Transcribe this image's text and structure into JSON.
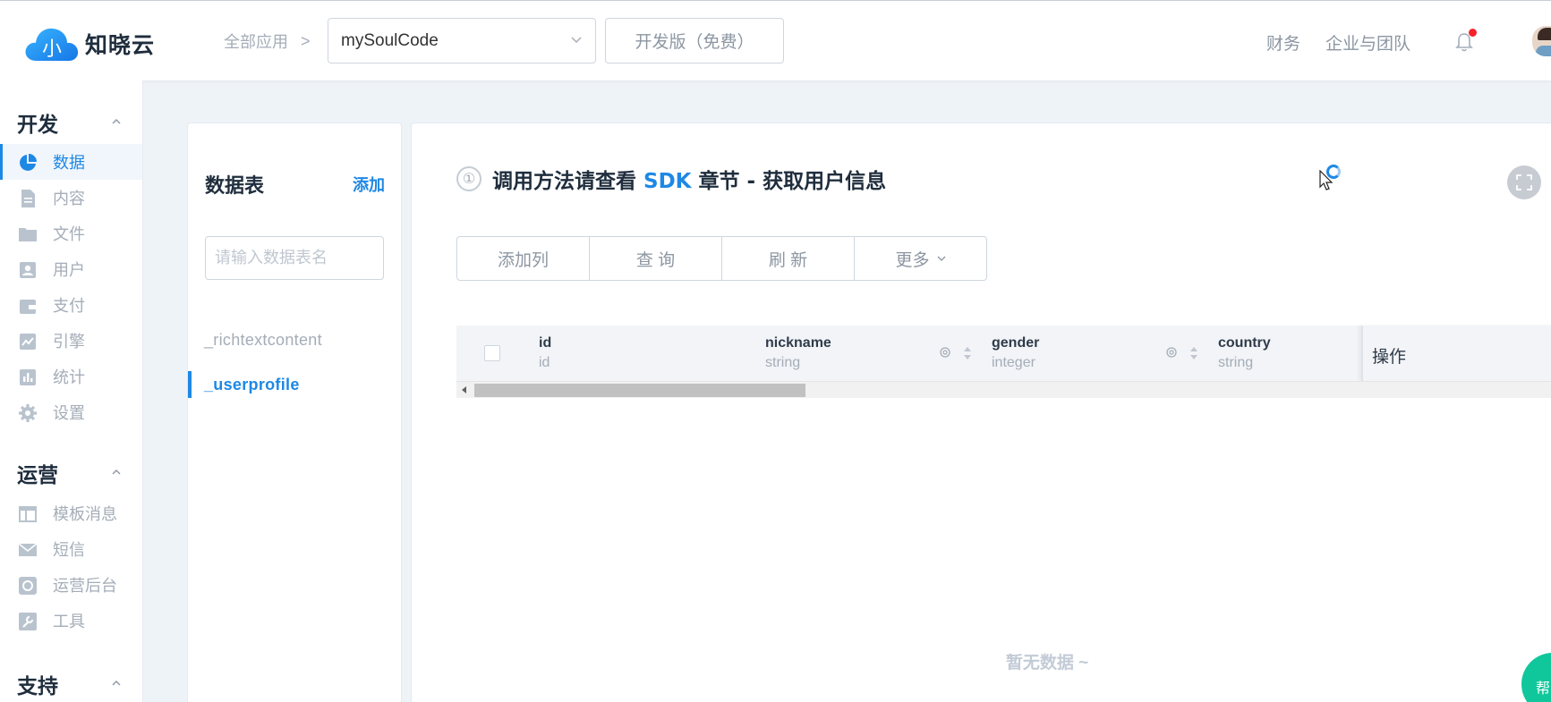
{
  "brand": {
    "name": "知晓云",
    "logo_glyph": "小",
    "brand_color": "#1e88e5"
  },
  "header": {
    "breadcrumb": "全部应用",
    "breadcrumb_separator": ">",
    "app_selected": "mySoulCode",
    "plan_label": "开发版（免费）",
    "links": [
      "财务",
      "企业与团队"
    ],
    "notification_icon": "bell-icon",
    "has_unread": true
  },
  "sidebar": {
    "sections": [
      {
        "title": "开发",
        "items": [
          {
            "label": "数据",
            "icon": "pie-chart-icon",
            "active": true
          },
          {
            "label": "内容",
            "icon": "document-icon"
          },
          {
            "label": "文件",
            "icon": "folder-icon"
          },
          {
            "label": "用户",
            "icon": "user-card-icon"
          },
          {
            "label": "支付",
            "icon": "wallet-icon"
          },
          {
            "label": "引擎",
            "icon": "trend-chart-icon"
          },
          {
            "label": "统计",
            "icon": "bar-chart-icon"
          },
          {
            "label": "设置",
            "icon": "gear-icon"
          }
        ]
      },
      {
        "title": "运营",
        "items": [
          {
            "label": "模板消息",
            "icon": "template-icon"
          },
          {
            "label": "短信",
            "icon": "mail-icon"
          },
          {
            "label": "运营后台",
            "icon": "operations-icon"
          },
          {
            "label": "工具",
            "icon": "wrench-icon"
          }
        ]
      },
      {
        "title": "支持",
        "items": []
      }
    ]
  },
  "tables_panel": {
    "title": "数据表",
    "add_label": "添加",
    "search_placeholder": "请输入数据表名",
    "tables": [
      {
        "name": "_richtextcontent",
        "active": false
      },
      {
        "name": "_userprofile",
        "active": true
      }
    ]
  },
  "main": {
    "info_icon": "①",
    "info_prefix": "调用方法请查看",
    "info_sdk": "SDK",
    "info_suffix": "章节 - 获取用户信息",
    "toolbar": {
      "add_column": "添加列",
      "query": "查 询",
      "refresh": "刷 新",
      "more": "更多"
    },
    "columns": [
      {
        "name": "id",
        "type": "id"
      },
      {
        "name": "nickname",
        "type": "string"
      },
      {
        "name": "gender",
        "type": "integer"
      },
      {
        "name": "country",
        "type": "string"
      }
    ],
    "ops_label": "操作",
    "empty_text": "暂无数据 ~",
    "help_label": "帮"
  }
}
